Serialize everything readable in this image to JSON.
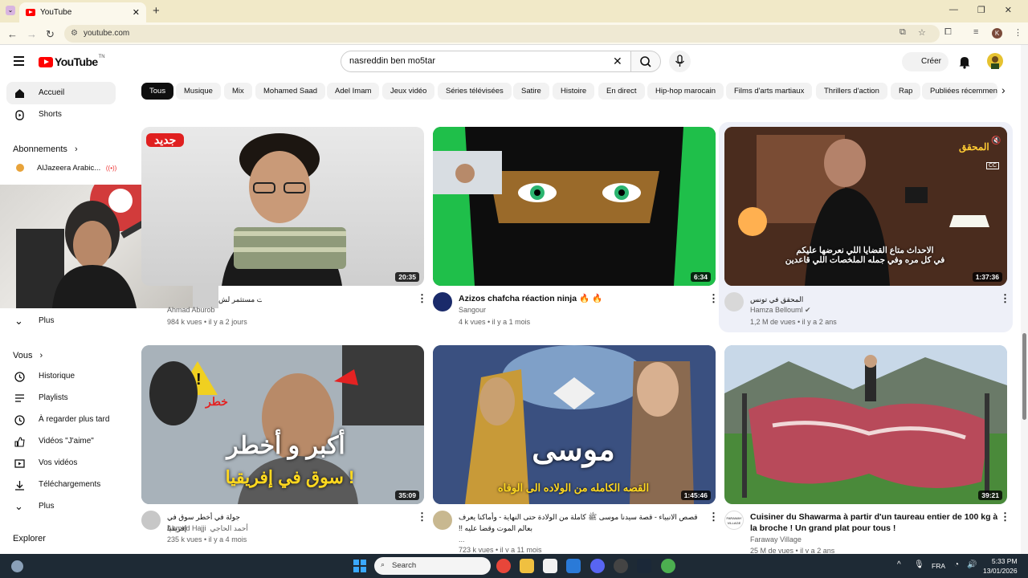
{
  "browser": {
    "tab_title": "YouTube",
    "new_tab": "+",
    "url": "youtube.com"
  },
  "header": {
    "logo_text": "YouTube",
    "logo_region": "TN",
    "search_value": "nasreddin ben mo5tar",
    "create_label": "Créer"
  },
  "sidebar": {
    "items": [
      {
        "label": "Accueil",
        "icon": "home-icon"
      },
      {
        "label": "Shorts",
        "icon": "shorts-icon"
      }
    ],
    "subs_heading": "Abonnements",
    "subs": [
      {
        "label": "AlJazeera Arabic..."
      }
    ],
    "more1": "Plus",
    "you_heading": "Vous",
    "you_items": [
      {
        "label": "Historique",
        "icon": "history-icon"
      },
      {
        "label": "Playlists",
        "icon": "playlist-icon"
      },
      {
        "label": "À regarder plus tard",
        "icon": "clock-icon"
      },
      {
        "label": "Vidéos \"J'aime\"",
        "icon": "thumb-up-icon"
      },
      {
        "label": "Vos vidéos",
        "icon": "video-icon"
      },
      {
        "label": "Téléchargements",
        "icon": "download-icon"
      }
    ],
    "more2": "Plus",
    "explore_heading": "Explorer"
  },
  "chips": [
    "Tous",
    "Musique",
    "Mix",
    "Mohamed Saad",
    "Adel Imam",
    "Jeux vidéo",
    "Séries télévisées",
    "Satire",
    "Histoire",
    "En direct",
    "Hip-hop marocain",
    "Films d'arts martiaux",
    "Thrillers d'action",
    "Rap",
    "Publiées récemmen"
  ],
  "videos": [
    {
      "badge": "جديد",
      "duration": "20:35",
      "title": "جبت مستثمر لش...",
      "channel": "Ahmad Aburob",
      "meta": "984 k vues • il y a 2 jours"
    },
    {
      "duration": "6:34",
      "title": "Azizos chafcha réaction ninja 🔥 🔥",
      "channel": "Sangour",
      "meta": "4 k vues • il y a 1 mois"
    },
    {
      "duration": "1:37:36",
      "overlay": "الاحداث متاع القضايا اللي نعرضها عليكم\nفي كل مره وفي جمله الملخصات اللي قاعدين",
      "title": "المحقق في تونس",
      "channel": "Hamza Bellouml",
      "meta": "1,2 M de vues • il y a 2 ans",
      "corner_label": "المحقق",
      "cc": "CC"
    },
    {
      "duration": "35:09",
      "overlay1": "أكبر و أخطر",
      "overlay2": "سوق في إفريقيا !",
      "warn": "خطر",
      "title": "جولة في أخطر سوق في إفريقيا",
      "channel": "Ahmed Hajji",
      "channel_ar": "أحمد الحاجي",
      "meta": "235 k vues • il y a 4 mois"
    },
    {
      "duration": "1:45:46",
      "overlay1": "موسى",
      "overlay2": "القصه الكامله من الولاده الى الوفاه",
      "title": "قصص الانبياء - قصة سيدنا موسى ﷺ كاملة من الولادة حتى النهاية - وأماكنا يعرف بعالم الموت وقضا عليه !!",
      "channel": "...",
      "meta": "723 k vues • il y a 11 mois"
    },
    {
      "duration": "39:21",
      "title": "Cuisiner du Shawarma à partir d'un taureau entier de 100 kg à la broche ! Un grand plat pour tous !",
      "channel": "Faraway Village",
      "avatar_text": "FARAWAY VILLAGE",
      "meta": "25 M de vues • il y a 2 ans"
    }
  ],
  "taskbar": {
    "search_placeholder": "Search",
    "lang": "FRA",
    "time": "5:33 PM",
    "date": "13/01/2026"
  },
  "colors": {
    "yt_red": "#ff0000",
    "chrome_bg": "#f1e9c8",
    "taskbar": "#1e2a35"
  }
}
